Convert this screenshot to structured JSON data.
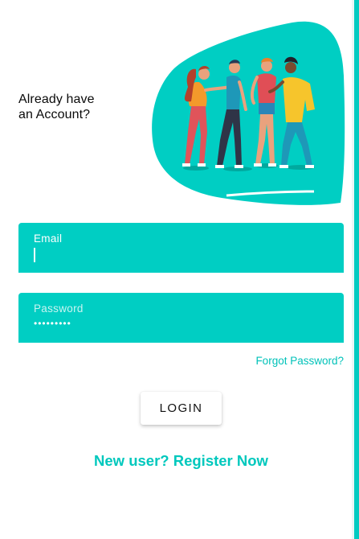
{
  "colors": {
    "accent": "#00cec3",
    "accent_text": "#00c2b9",
    "background": "#ffffff"
  },
  "header": {
    "heading": "Already have an Account?"
  },
  "illustration": {
    "icon": "people-group-illustration"
  },
  "form": {
    "email": {
      "label": "Email",
      "value": ""
    },
    "password": {
      "label": "Password",
      "value": "•••••••••"
    },
    "forgot_password": "Forgot Password?",
    "login_label": "LOGIN"
  },
  "footer": {
    "register_link": "New user? Register Now"
  }
}
